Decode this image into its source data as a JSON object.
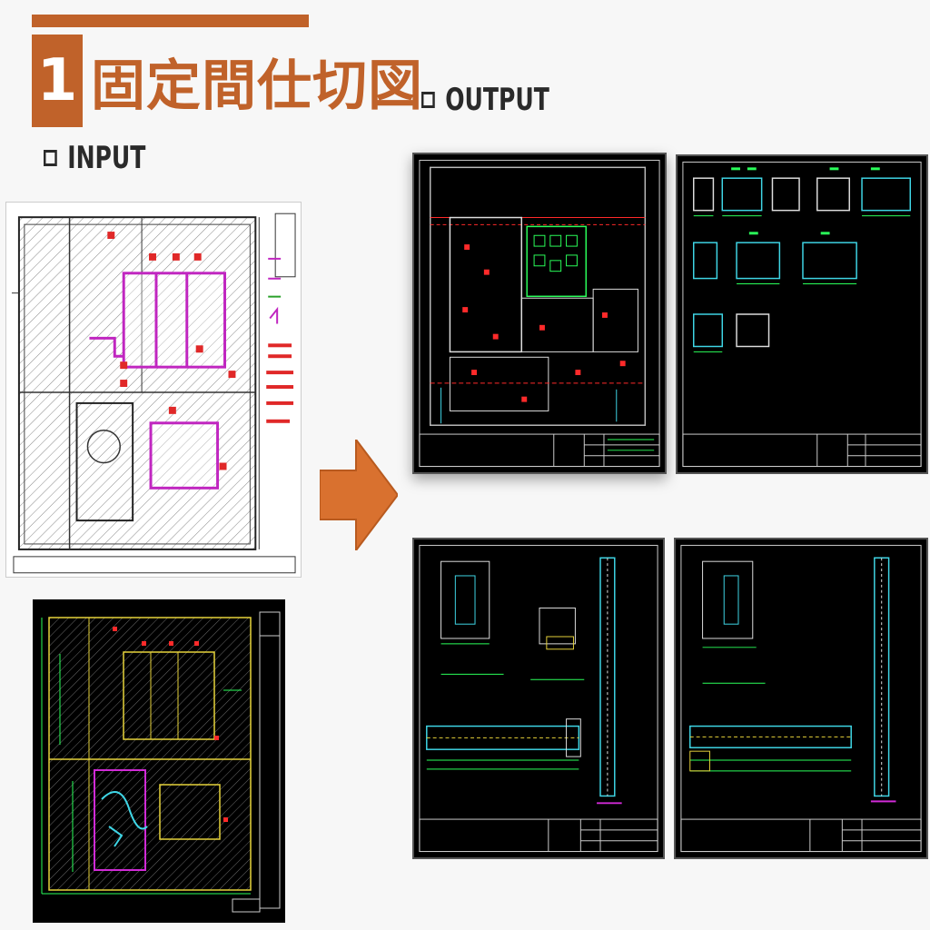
{
  "header": {
    "section_number": "1",
    "title": "固定間仕切図"
  },
  "input": {
    "label": "INPUT"
  },
  "output": {
    "label": "OUTPUT"
  },
  "colors": {
    "accent": "#c0622a",
    "drawing_bg": "#000000",
    "cad_green": "#2aff5a",
    "cad_cyan": "#3fd6e6",
    "cad_red": "#ff2a2a",
    "cad_yellow": "#e6d23a",
    "cad_magenta": "#d02ad6"
  },
  "icons": {
    "checkbox": "checkbox-icon",
    "arrow": "right-arrow-icon"
  }
}
